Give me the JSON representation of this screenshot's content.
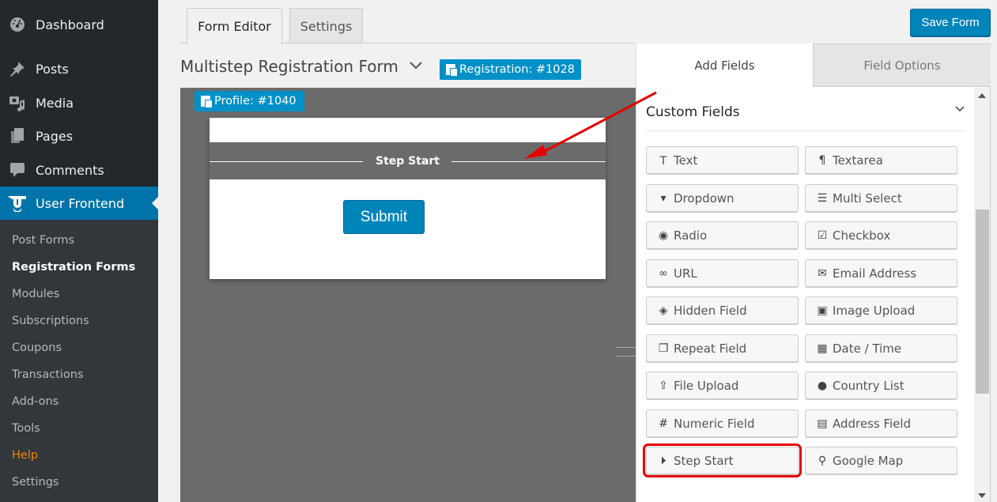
{
  "sidebar": {
    "items": [
      {
        "label": "Dashboard",
        "icon": "dashboard-icon"
      },
      {
        "label": "Posts",
        "icon": "pin-icon"
      },
      {
        "label": "Media",
        "icon": "media-icon"
      },
      {
        "label": "Pages",
        "icon": "pages-icon"
      },
      {
        "label": "Comments",
        "icon": "comment-icon"
      },
      {
        "label": "User Frontend",
        "icon": "user-frontend-logo-icon",
        "current": true
      }
    ],
    "submenu": [
      {
        "label": "Post Forms"
      },
      {
        "label": "Registration Forms",
        "active": true
      },
      {
        "label": "Modules"
      },
      {
        "label": "Subscriptions"
      },
      {
        "label": "Coupons"
      },
      {
        "label": "Transactions"
      },
      {
        "label": "Add-ons"
      },
      {
        "label": "Tools"
      },
      {
        "label": "Help"
      },
      {
        "label": "Settings"
      }
    ]
  },
  "tabs": {
    "form_editor": "Form Editor",
    "settings": "Settings",
    "active": "Form Editor"
  },
  "toolbar": {
    "save_label": "Save Form"
  },
  "form": {
    "title": "Multistep Registration Form",
    "registration_badge": "Registration: #1028",
    "profile_badge": "Profile: #1040",
    "step_label": "Step Start",
    "submit_label": "Submit"
  },
  "panel": {
    "tabs": {
      "add_fields": "Add Fields",
      "field_options": "Field Options",
      "active": "Add Fields"
    },
    "section_title": "Custom Fields",
    "fields": [
      {
        "label": "Text",
        "icon": "text-cursor-icon",
        "glyph": "Ｔ"
      },
      {
        "label": "Textarea",
        "icon": "paragraph-icon",
        "glyph": "¶"
      },
      {
        "label": "Dropdown",
        "icon": "dropdown-icon",
        "glyph": "▾"
      },
      {
        "label": "Multi Select",
        "icon": "list-icon",
        "glyph": "☰"
      },
      {
        "label": "Radio",
        "icon": "radio-icon",
        "glyph": "◉"
      },
      {
        "label": "Checkbox",
        "icon": "checkbox-icon",
        "glyph": "☑"
      },
      {
        "label": "URL",
        "icon": "link-icon",
        "glyph": "∞"
      },
      {
        "label": "Email Address",
        "icon": "envelope-icon",
        "glyph": "✉"
      },
      {
        "label": "Hidden Field",
        "icon": "eye-slash-icon",
        "glyph": "◈"
      },
      {
        "label": "Image Upload",
        "icon": "image-icon",
        "glyph": "▣"
      },
      {
        "label": "Repeat Field",
        "icon": "clone-icon",
        "glyph": "❐"
      },
      {
        "label": "Date / Time",
        "icon": "calendar-icon",
        "glyph": "▦"
      },
      {
        "label": "File Upload",
        "icon": "upload-icon",
        "glyph": "⇪"
      },
      {
        "label": "Country List",
        "icon": "globe-icon",
        "glyph": "●"
      },
      {
        "label": "Numeric Field",
        "icon": "hash-icon",
        "glyph": "#"
      },
      {
        "label": "Address Field",
        "icon": "address-card-icon",
        "glyph": "▤"
      },
      {
        "label": "Step Start",
        "icon": "step-forward-icon",
        "glyph": "⏵",
        "highlighted": true
      },
      {
        "label": "Google Map",
        "icon": "map-marker-icon",
        "glyph": "⚲"
      }
    ]
  },
  "colors": {
    "accent": "#0085ba",
    "sidebar_bg": "#23282d",
    "submenu_bg": "#32373c",
    "current_menu": "#0073aa",
    "help_link": "#f18500",
    "badge": "#0090c8",
    "canvas": "#6b6b6b",
    "annotation": "#e40000"
  },
  "annotation": {
    "type": "red-arrow",
    "from": "panel",
    "to": "step-start-divider"
  }
}
